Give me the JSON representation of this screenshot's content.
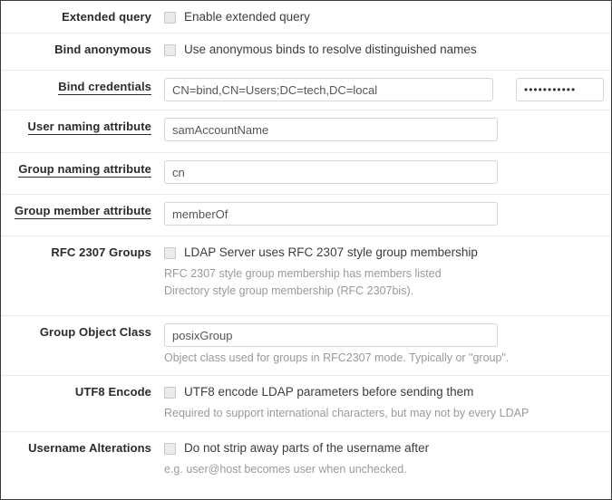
{
  "form": {
    "rows": [
      {
        "id": "extended-query",
        "label": "Extended query",
        "label_underlined": false,
        "type": "checkbox",
        "checkbox_label": "Enable extended query",
        "checked": false
      },
      {
        "id": "bind-anonymous",
        "label": "Bind anonymous",
        "label_underlined": false,
        "type": "checkbox",
        "checkbox_label": "Use anonymous binds to resolve distinguished names",
        "checked": false
      },
      {
        "id": "bind-credentials",
        "label": "Bind credentials",
        "label_underlined": true,
        "type": "text-and-password",
        "value": "CN=bind,CN=Users;DC=tech,DC=local",
        "password_value": "•••••••••••",
        "password_masked": true
      },
      {
        "id": "user-naming-attribute",
        "label": "User naming attribute",
        "label_underlined": true,
        "type": "text",
        "value": "samAccountName"
      },
      {
        "id": "group-naming-attribute",
        "label": "Group naming attribute",
        "label_underlined": true,
        "type": "text",
        "value": "cn"
      },
      {
        "id": "group-member-attribute",
        "label": "Group member attribute",
        "label_underlined": true,
        "type": "text",
        "value": "memberOf"
      },
      {
        "id": "rfc-2307-groups",
        "label": "RFC 2307 Groups",
        "label_underlined": false,
        "type": "checkbox-with-help",
        "checkbox_label": "LDAP Server uses RFC 2307 style group membership",
        "checked": false,
        "help_lines": [
          "RFC 2307 style group membership has members listed",
          "Directory style group membership (RFC 2307bis)."
        ]
      },
      {
        "id": "group-object-class",
        "label": "Group Object Class",
        "label_underlined": false,
        "type": "text-with-help",
        "value": "posixGroup",
        "help_lines": [
          "Object class used for groups in RFC2307 mode. Typically or \"group\"."
        ]
      },
      {
        "id": "utf8-encode",
        "label": "UTF8 Encode",
        "label_underlined": false,
        "type": "checkbox-with-help",
        "checkbox_label": "UTF8 encode LDAP parameters before sending them",
        "checked": false,
        "help_lines": [
          "Required to support international characters, but may not by every LDAP"
        ]
      },
      {
        "id": "username-alterations",
        "label": "Username Alterations",
        "label_underlined": false,
        "type": "checkbox-with-help",
        "checkbox_label": "Do not strip away parts of the username after",
        "checked": false,
        "help_lines": [
          "e.g. user@host becomes user when unchecked."
        ]
      }
    ]
  },
  "colors": {
    "border": "#3a3a3a",
    "divider": "#eaeaea",
    "label": "#2b2b2b",
    "text": "#3d3d3d",
    "help": "#9a9a9a",
    "input_border": "#d5d5d5",
    "checkbox_fill": "#ebebeb"
  }
}
